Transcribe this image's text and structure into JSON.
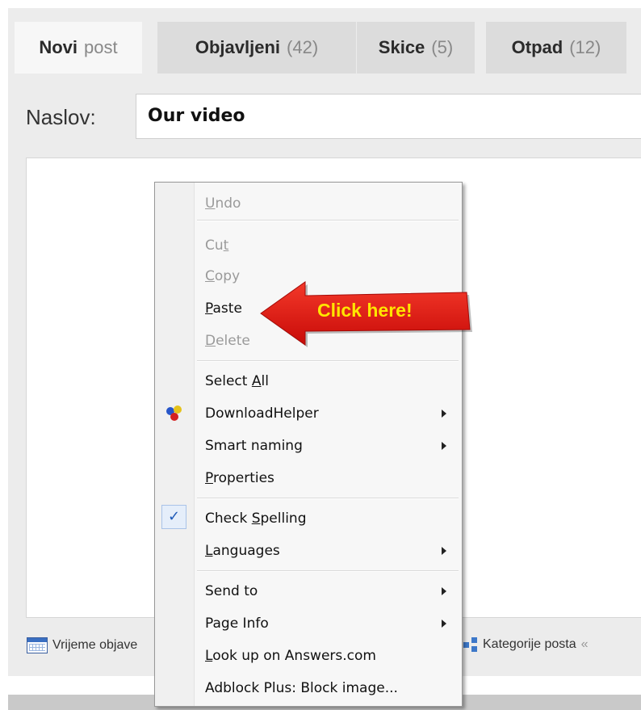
{
  "tabs": [
    {
      "name": "Novi",
      "count": "post"
    },
    {
      "name": "Objavljeni",
      "count": "(42)"
    },
    {
      "name": "Skice",
      "count": "(5)"
    },
    {
      "name": "Otpad",
      "count": "(12)"
    }
  ],
  "title_label": "Naslov:",
  "title_value": "Our video",
  "status": {
    "left_label": "Vrijeme objave",
    "right_label": "Kategorije posta",
    "right_chevron": "«"
  },
  "context_menu": {
    "undo": {
      "pre": "",
      "ul": "U",
      "post": "ndo"
    },
    "cut": {
      "pre": "Cu",
      "ul": "t",
      "post": ""
    },
    "copy": {
      "pre": "",
      "ul": "C",
      "post": "opy"
    },
    "paste": {
      "pre": "",
      "ul": "P",
      "post": "aste"
    },
    "delete": {
      "pre": "",
      "ul": "D",
      "post": "elete"
    },
    "select_all": {
      "pre": "Select ",
      "ul": "A",
      "post": "ll"
    },
    "download_helper": "DownloadHelper",
    "smart_naming": "Smart naming",
    "properties": {
      "pre": "",
      "ul": "P",
      "post": "roperties"
    },
    "check_spelling": {
      "pre": "Check ",
      "ul": "S",
      "post": "pelling"
    },
    "check_mark": "✓",
    "languages": {
      "pre": "",
      "ul": "L",
      "post": "anguages"
    },
    "send_to": "Send to",
    "page_info": "Page Info",
    "look_up": {
      "pre": "",
      "ul": "L",
      "post": "ook up on Answers.com"
    },
    "adblock": "Adblock Plus: Block image..."
  },
  "callout_text": "Click here!",
  "colors": {
    "callout_red": "#e3130f",
    "callout_text": "#ffe600",
    "check_blue": "#1f5bb8"
  }
}
